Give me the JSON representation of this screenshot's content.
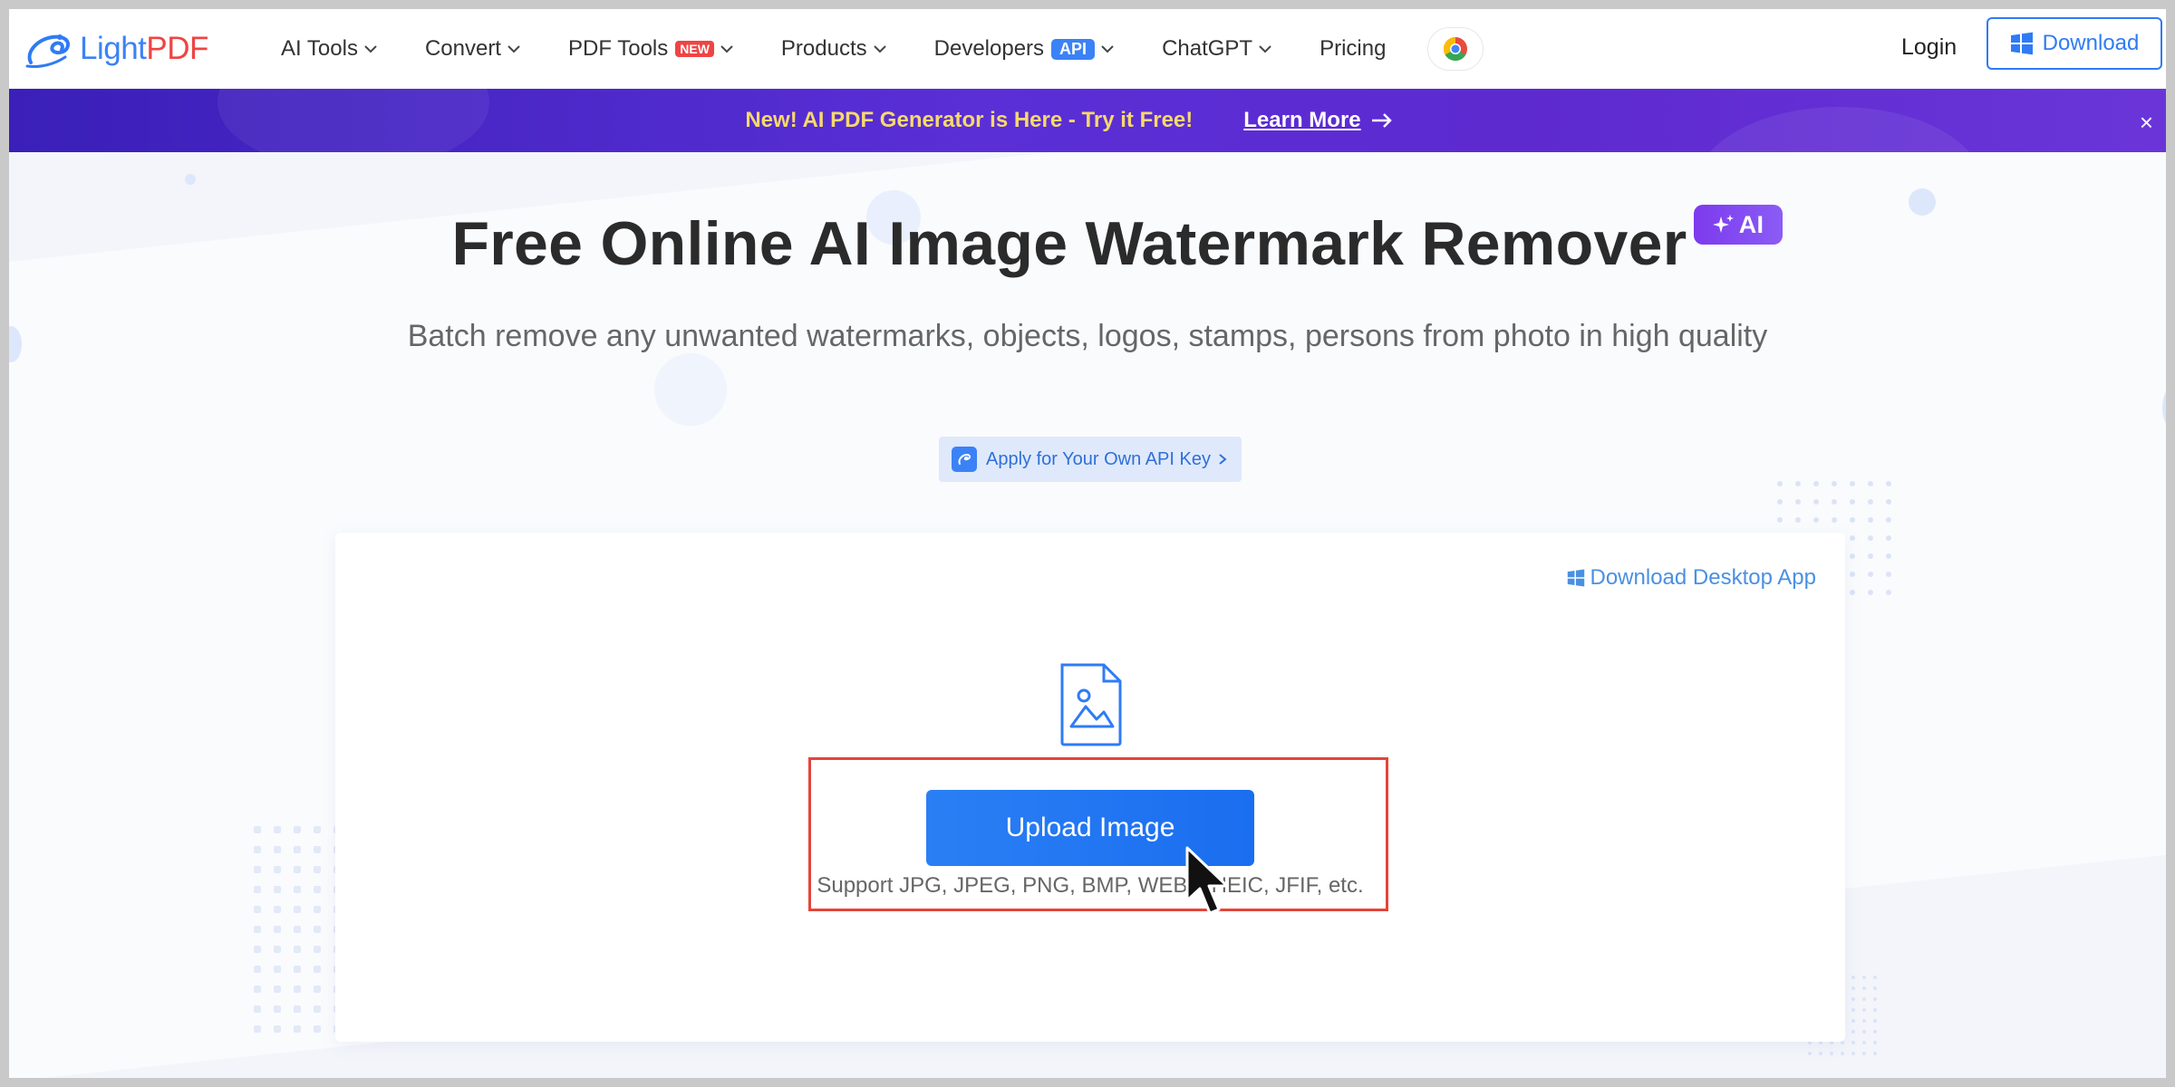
{
  "brand": {
    "name_left": "Light",
    "name_right": "PDF"
  },
  "nav": {
    "items": [
      {
        "label": "AI Tools",
        "has_chevron": true
      },
      {
        "label": "Convert",
        "has_chevron": true
      },
      {
        "label": "PDF Tools",
        "badge": "NEW",
        "has_chevron": true
      },
      {
        "label": "Products",
        "has_chevron": true
      },
      {
        "label": "Developers",
        "badge": "API",
        "has_chevron": true
      },
      {
        "label": "ChatGPT",
        "has_chevron": true
      },
      {
        "label": "Pricing",
        "has_chevron": false
      }
    ],
    "login": "Login",
    "download": "Download"
  },
  "banner": {
    "text": "New! AI PDF Generator is Here - Try it Free!",
    "link": "Learn More",
    "close": "×"
  },
  "hero": {
    "title": "Free Online AI Image Watermark Remover",
    "ai_badge": "AI",
    "subtitle": "Batch remove any unwanted watermarks, objects, logos, stamps, persons from photo in high quality",
    "api_key": "Apply for Your Own API Key"
  },
  "card": {
    "desktop_link": "Download Desktop App",
    "upload_button": "Upload Image",
    "support_text": "Support JPG, JPEG, PNG, BMP, WEBP, HEIC, JFIF, etc."
  },
  "colors": {
    "accent": "#2f7bf5",
    "banner": "#4a26c8",
    "highlight": "#e5443a"
  }
}
